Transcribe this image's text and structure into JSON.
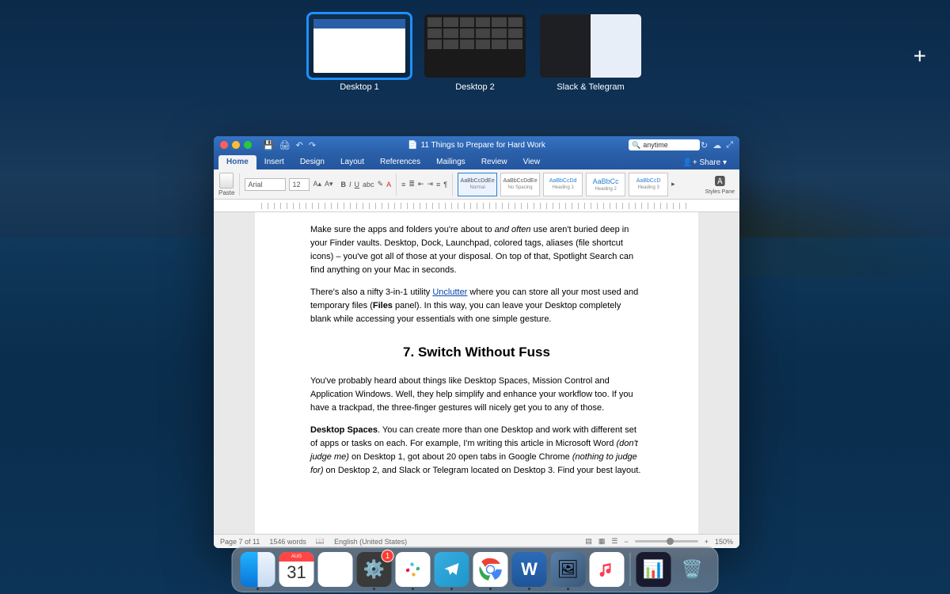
{
  "mission_control": {
    "desktops": [
      {
        "label": "Desktop 1",
        "selected": true
      },
      {
        "label": "Desktop 2",
        "selected": false
      },
      {
        "label": "Slack & Telegram",
        "selected": false
      }
    ],
    "add_label": "+"
  },
  "word": {
    "titlebar": {
      "doc_title": "11 Things to Prepare for Hard Work",
      "search_value": "anytime",
      "search_prefix": "🔍"
    },
    "tabs": [
      "Home",
      "Insert",
      "Design",
      "Layout",
      "References",
      "Mailings",
      "Review",
      "View"
    ],
    "active_tab": "Home",
    "share_label": "Share",
    "ribbon": {
      "paste_label": "Paste",
      "font_name": "Arial",
      "font_size": "12",
      "styles": [
        {
          "sample": "AaBbCcDdEe",
          "name": "Normal",
          "sel": true
        },
        {
          "sample": "AaBbCcDdEe",
          "name": "No Spacing",
          "sel": false
        },
        {
          "sample": "AaBbCcDd",
          "name": "Heading 1",
          "sel": false
        },
        {
          "sample": "AaBbCc",
          "name": "Heading 2",
          "sel": false
        },
        {
          "sample": "AaBbCcD",
          "name": "Heading 3",
          "sel": false
        }
      ],
      "styles_pane_label": "Styles Pane"
    },
    "document": {
      "p1_a": "Make sure the apps and folders you're about to ",
      "p1_b": "and often",
      "p1_c": " use aren't buried deep in your Finder vaults. Desktop, Dock, Launchpad, colored tags, aliases (file shortcut icons) – you've got all of those at your disposal. On top of that, Spotlight Search can find anything on your Mac in seconds.",
      "p2_a": "There's also a nifty 3-in-1 utility ",
      "p2_link": "Unclutter",
      "p2_b": " where you can store all your most used and temporary files (",
      "p2_c": "Files",
      "p2_d": " panel). In this way, you can leave your Desktop completely blank while accessing your essentials with one simple gesture.",
      "h2": "7. Switch Without Fuss",
      "p3": "You've probably heard about things like Desktop Spaces, Mission Control and Application Windows. Well, they help simplify and enhance your workflow too. If you have a trackpad, the three-finger gestures will nicely get you to any of those.",
      "p4_a": "Desktop Spaces",
      "p4_b": ". You can create more than one Desktop and work with different set of apps or tasks on each. For example, I'm writing this article in Microsoft Word ",
      "p4_c": "(don't judge me)",
      "p4_d": " on Desktop 1, got about 20 open tabs in Google Chrome ",
      "p4_e": "(nothing to judge for)",
      "p4_f": " on Desktop 2, and Slack or Telegram located on Desktop 3. Find your best layout."
    },
    "status": {
      "page": "Page 7 of 11",
      "words": "1546 words",
      "language": "English (United States)",
      "zoom": "150%"
    }
  },
  "dock": {
    "calendar": {
      "month": "AUG",
      "day": "31"
    },
    "settings_badge": "1"
  }
}
